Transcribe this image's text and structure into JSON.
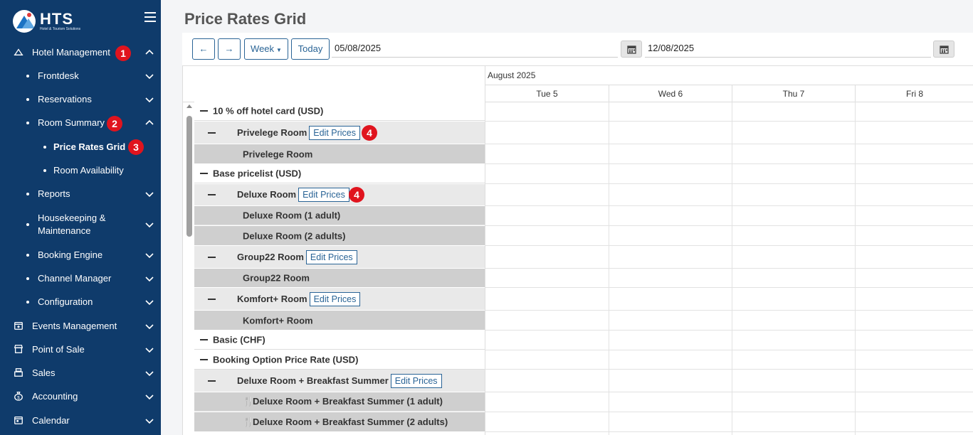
{
  "brand": {
    "title": "HTS",
    "subtitle": "Hotel & Tourism Solutions"
  },
  "sidebar": {
    "items": [
      {
        "label": "Hotel Management",
        "icon": "home-icon",
        "badge": "1",
        "expanded": true
      },
      {
        "label": "Frontdesk"
      },
      {
        "label": "Reservations"
      },
      {
        "label": "Room Summary",
        "badge": "2",
        "expanded": true
      },
      {
        "label": "Price Rates Grid",
        "badge": "3",
        "active": true
      },
      {
        "label": "Room Availability"
      },
      {
        "label": "Reports"
      },
      {
        "label": "Housekeeping &",
        "label2": "Maintenance"
      },
      {
        "label": "Booking Engine"
      },
      {
        "label": "Channel Manager"
      },
      {
        "label": "Configuration"
      },
      {
        "label": "Events Management",
        "icon": "calendar-plus-icon"
      },
      {
        "label": "Point of Sale",
        "icon": "store-icon"
      },
      {
        "label": "Sales",
        "icon": "cash-register-icon"
      },
      {
        "label": "Accounting",
        "icon": "money-bag-icon"
      },
      {
        "label": "Calendar",
        "icon": "calendar-icon"
      }
    ]
  },
  "page": {
    "title": "Price Rates Grid"
  },
  "toolbar": {
    "prev_label": "←",
    "next_label": "→",
    "view_label": "Week",
    "today_label": "Today",
    "start_date": "05/08/2025",
    "end_date": "12/08/2025"
  },
  "grid": {
    "month": "August 2025",
    "days": [
      "Tue 5",
      "Wed 6",
      "Thu 7",
      "Fri 8"
    ],
    "edit_label": "Edit Prices",
    "edit_badge": "4",
    "rows": [
      {
        "label": "10 % off hotel card (USD)"
      },
      {
        "label": "Privelege Room"
      },
      {
        "label": "Privelege Room"
      },
      {
        "label": "Base pricelist (USD)"
      },
      {
        "label": "Deluxe Room"
      },
      {
        "label": "Deluxe Room (1 adult)"
      },
      {
        "label": "Deluxe Room (2 adults)"
      },
      {
        "label": "Group22 Room"
      },
      {
        "label": "Group22 Room"
      },
      {
        "label": "Komfort+ Room"
      },
      {
        "label": "Komfort+ Room"
      },
      {
        "label": "Basic (CHF)"
      },
      {
        "label": "Booking Option Price Rate (USD)"
      },
      {
        "label": "Deluxe Room + Breakfast Summer"
      },
      {
        "label": "Deluxe Room + Breakfast Summer (1 adult)"
      },
      {
        "label": "Deluxe Room + Breakfast Summer (2 adults)"
      }
    ]
  },
  "colors": {
    "sidebar": "#0f3b6b",
    "accent": "#2a6496",
    "badge": "#e0141e"
  }
}
